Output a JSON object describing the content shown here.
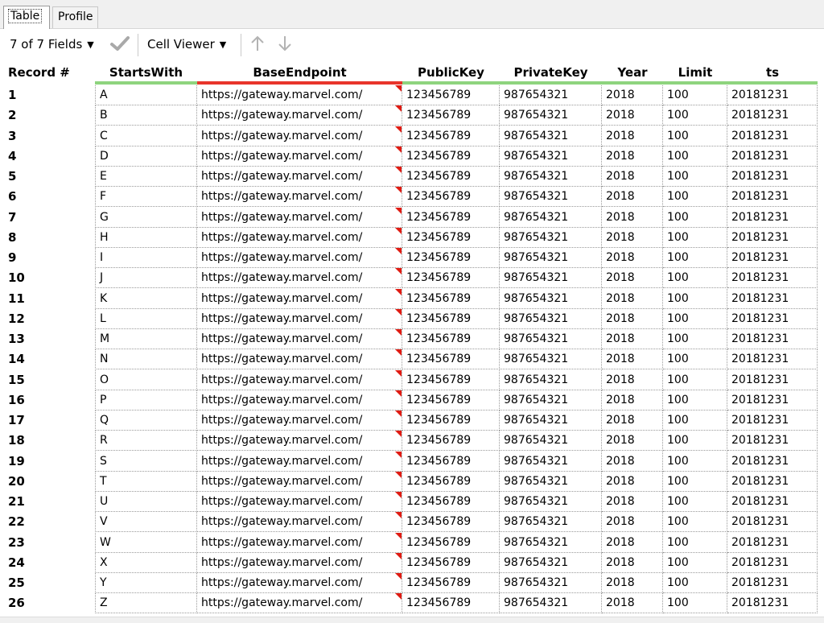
{
  "tabs": [
    {
      "label": "Table",
      "active": true
    },
    {
      "label": "Profile",
      "active": false
    }
  ],
  "toolbar": {
    "fields_label": "7 of 7 Fields",
    "cell_viewer_label": "Cell Viewer",
    "caret_icon": "dropdown-caret-icon",
    "check_icon": "checkmark-icon",
    "up_icon": "arrow-up-icon",
    "down_icon": "arrow-down-icon"
  },
  "colors": {
    "header_underline": "#8ed47e",
    "sorted_underline": "#e8352b",
    "flag": "#e01b12"
  },
  "table": {
    "record_header": "Record #",
    "columns": [
      "StartsWith",
      "BaseEndpoint",
      "PublicKey",
      "PrivateKey",
      "Year",
      "Limit",
      "ts"
    ],
    "endpoint": "https://gateway.marvel.com/",
    "public_key": "123456789",
    "private_key": "987654321",
    "year": "2018",
    "limit": "100",
    "ts": "20181231",
    "letters": [
      "A",
      "B",
      "C",
      "D",
      "E",
      "F",
      "G",
      "H",
      "I",
      "J",
      "K",
      "L",
      "M",
      "N",
      "O",
      "P",
      "Q",
      "R",
      "S",
      "T",
      "U",
      "V",
      "W",
      "X",
      "Y",
      "Z"
    ]
  }
}
